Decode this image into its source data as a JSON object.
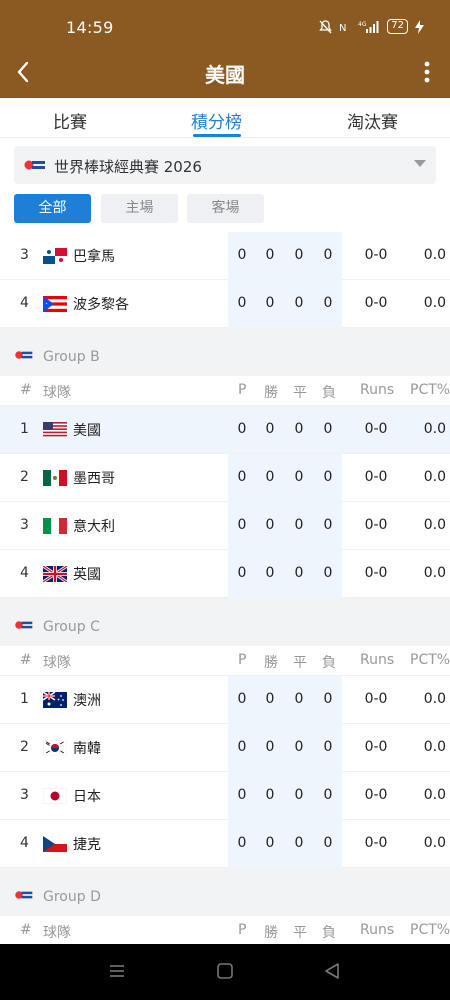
{
  "status": {
    "time": "14:59",
    "battery": "72",
    "signal": "4G"
  },
  "header": {
    "title": "美國"
  },
  "tabs": [
    {
      "label": "比賽"
    },
    {
      "label": "積分榜"
    },
    {
      "label": "淘汰賽"
    }
  ],
  "league": {
    "name": "世界棒球經典賽 2026"
  },
  "filters": [
    {
      "label": "全部"
    },
    {
      "label": "主場"
    },
    {
      "label": "客場"
    }
  ],
  "columns": {
    "rank": "#",
    "team": "球隊",
    "p": "P",
    "w": "勝",
    "d": "平",
    "l": "負",
    "runs": "Runs",
    "pct": "PCT%"
  },
  "groupA_partial": [
    {
      "rank": "3",
      "team": "巴拿馬",
      "flag": "panama",
      "p": "0",
      "w": "0",
      "d": "0",
      "l": "0",
      "runs": "0-0",
      "pct": "0.0"
    },
    {
      "rank": "4",
      "team": "波多黎各",
      "flag": "puerto-rico",
      "p": "0",
      "w": "0",
      "d": "0",
      "l": "0",
      "runs": "0-0",
      "pct": "0.0"
    }
  ],
  "groupB": {
    "name": "Group B",
    "rows": [
      {
        "rank": "1",
        "team": "美國",
        "flag": "usa",
        "p": "0",
        "w": "0",
        "d": "0",
        "l": "0",
        "runs": "0-0",
        "pct": "0.0"
      },
      {
        "rank": "2",
        "team": "墨西哥",
        "flag": "mexico",
        "p": "0",
        "w": "0",
        "d": "0",
        "l": "0",
        "runs": "0-0",
        "pct": "0.0"
      },
      {
        "rank": "3",
        "team": "意大利",
        "flag": "italy",
        "p": "0",
        "w": "0",
        "d": "0",
        "l": "0",
        "runs": "0-0",
        "pct": "0.0"
      },
      {
        "rank": "4",
        "team": "英國",
        "flag": "uk",
        "p": "0",
        "w": "0",
        "d": "0",
        "l": "0",
        "runs": "0-0",
        "pct": "0.0"
      }
    ]
  },
  "groupC": {
    "name": "Group C",
    "rows": [
      {
        "rank": "1",
        "team": "澳洲",
        "flag": "australia",
        "p": "0",
        "w": "0",
        "d": "0",
        "l": "0",
        "runs": "0-0",
        "pct": "0.0"
      },
      {
        "rank": "2",
        "team": "南韓",
        "flag": "south-korea",
        "p": "0",
        "w": "0",
        "d": "0",
        "l": "0",
        "runs": "0-0",
        "pct": "0.0"
      },
      {
        "rank": "3",
        "team": "日本",
        "flag": "japan",
        "p": "0",
        "w": "0",
        "d": "0",
        "l": "0",
        "runs": "0-0",
        "pct": "0.0"
      },
      {
        "rank": "4",
        "team": "捷克",
        "flag": "czech",
        "p": "0",
        "w": "0",
        "d": "0",
        "l": "0",
        "runs": "0-0",
        "pct": "0.0"
      }
    ]
  },
  "groupD": {
    "name": "Group D"
  },
  "colors": {
    "header_bg": "#8a5a22",
    "accent": "#1f7fd6",
    "highlight": "#eef5fc"
  }
}
